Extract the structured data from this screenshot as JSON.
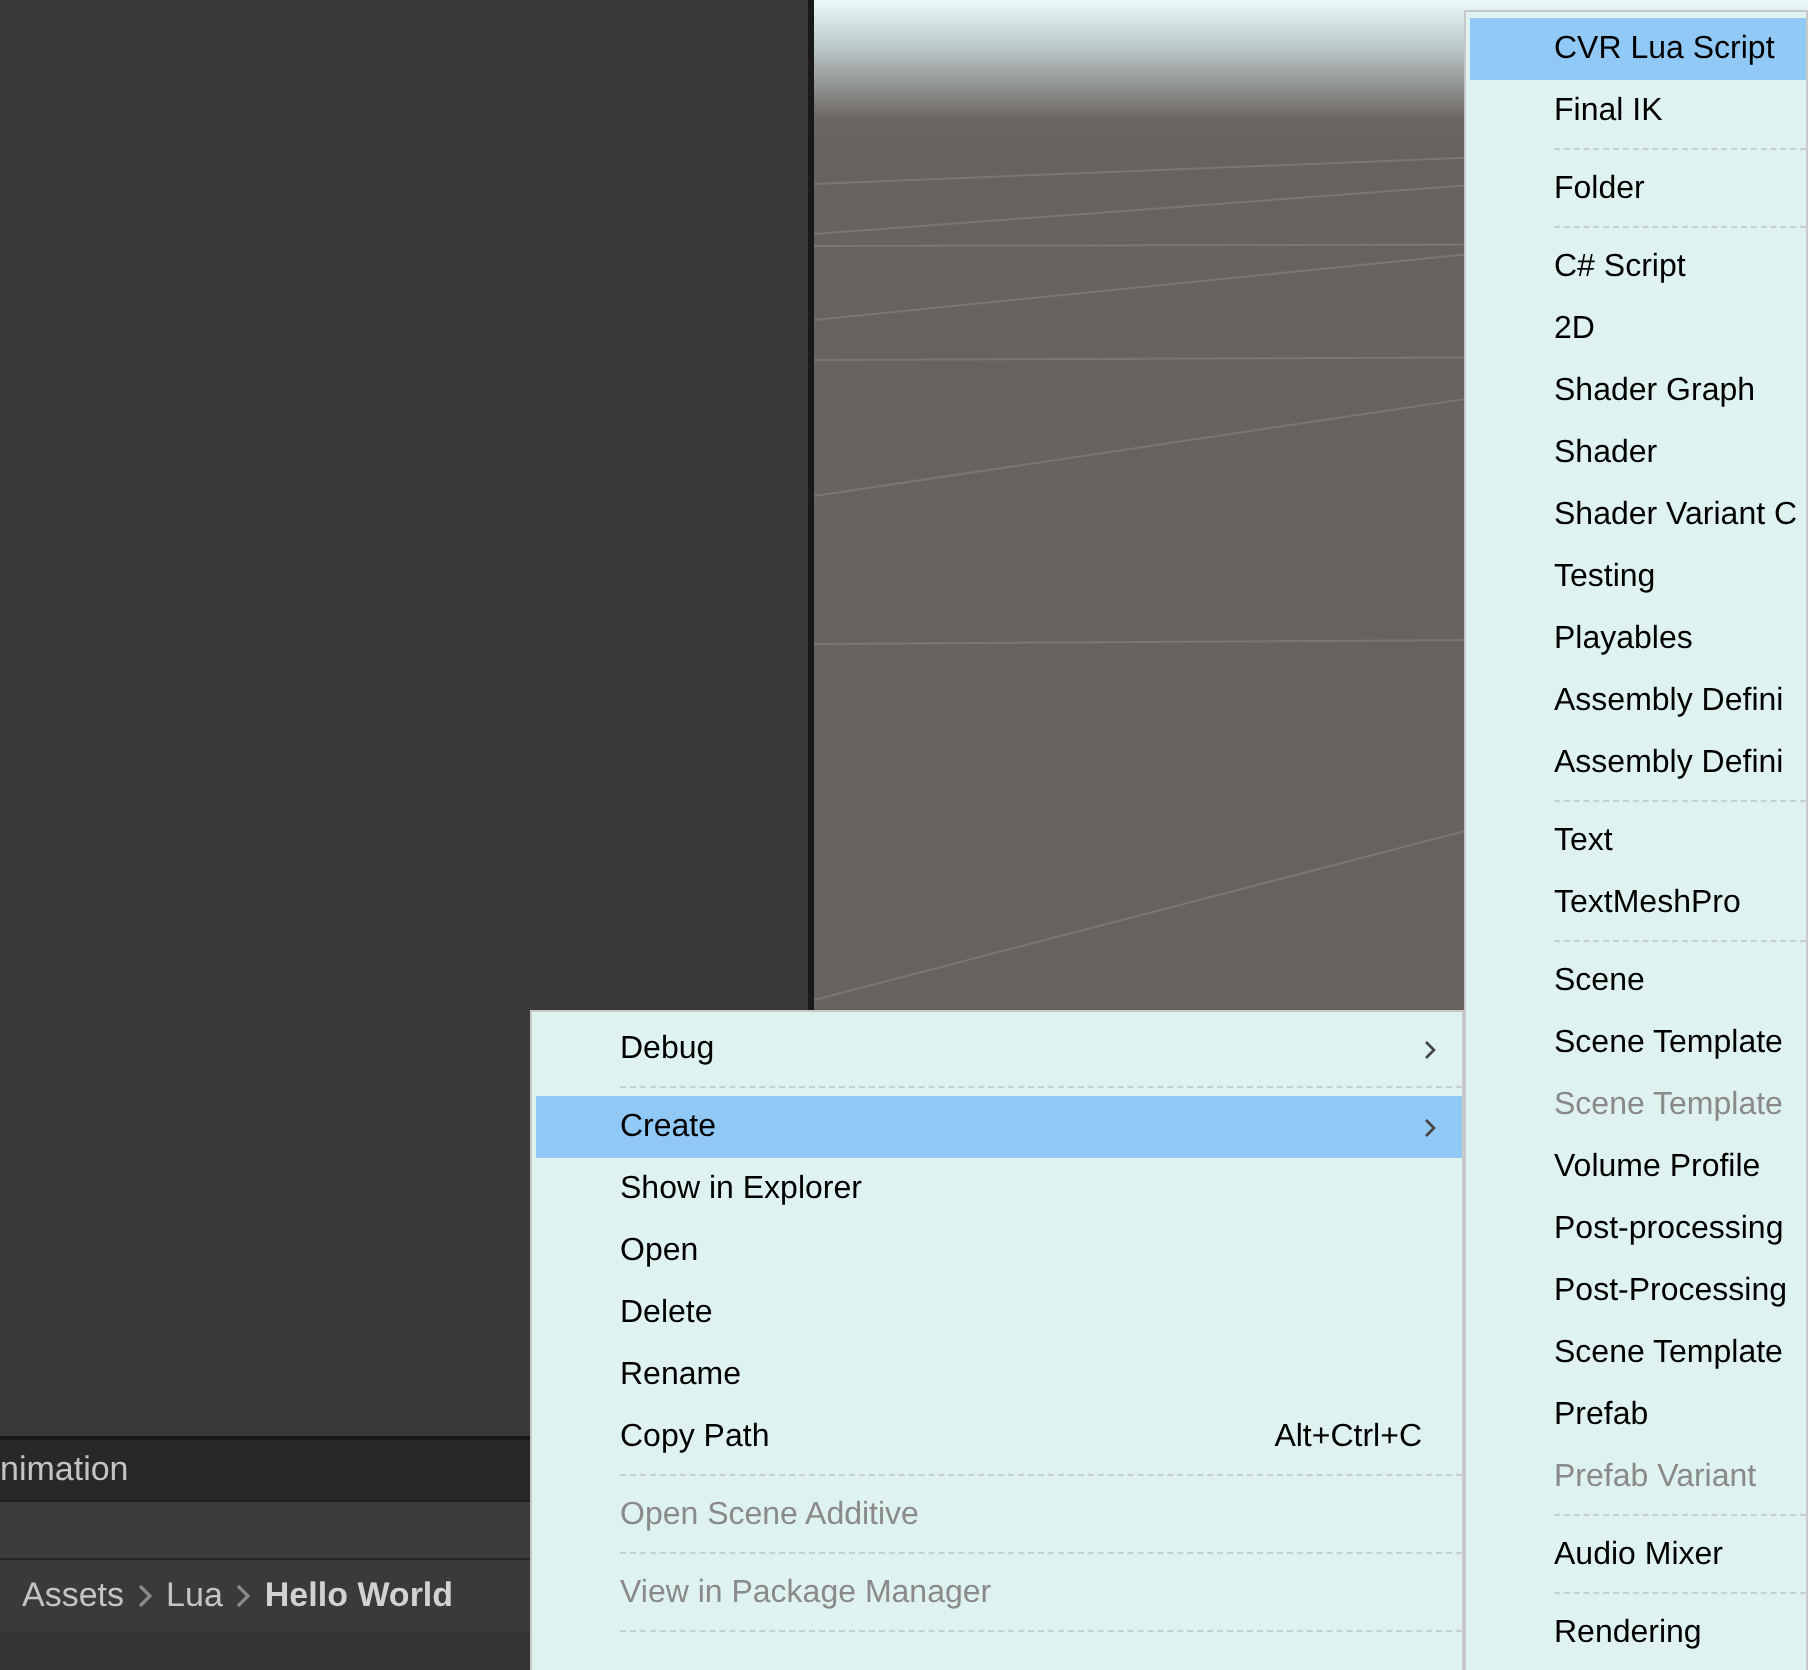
{
  "bottom_panel": {
    "tab": "nimation",
    "breadcrumb": [
      {
        "label": "Assets",
        "current": false
      },
      {
        "label": "Lua",
        "current": false
      },
      {
        "label": "Hello World",
        "current": true
      }
    ]
  },
  "context_menu": {
    "items": [
      {
        "kind": "item",
        "label": "Debug",
        "submenu": true,
        "selected": false,
        "disabled": false
      },
      {
        "kind": "separator"
      },
      {
        "kind": "item",
        "label": "Create",
        "submenu": true,
        "selected": true,
        "disabled": false
      },
      {
        "kind": "item",
        "label": "Show in Explorer",
        "submenu": false,
        "selected": false,
        "disabled": false
      },
      {
        "kind": "item",
        "label": "Open",
        "submenu": false,
        "selected": false,
        "disabled": false
      },
      {
        "kind": "item",
        "label": "Delete",
        "submenu": false,
        "selected": false,
        "disabled": false
      },
      {
        "kind": "item",
        "label": "Rename",
        "submenu": false,
        "selected": false,
        "disabled": false
      },
      {
        "kind": "item",
        "label": "Copy Path",
        "shortcut": "Alt+Ctrl+C",
        "submenu": false,
        "selected": false,
        "disabled": false
      },
      {
        "kind": "separator"
      },
      {
        "kind": "item",
        "label": "Open Scene Additive",
        "submenu": false,
        "selected": false,
        "disabled": true
      },
      {
        "kind": "separator"
      },
      {
        "kind": "item",
        "label": "View in Package Manager",
        "submenu": false,
        "selected": false,
        "disabled": true
      },
      {
        "kind": "separator"
      }
    ]
  },
  "create_submenu": {
    "items": [
      {
        "kind": "item",
        "label": "CVR Lua Script",
        "selected": true,
        "disabled": false
      },
      {
        "kind": "item",
        "label": "Final IK",
        "selected": false,
        "disabled": false
      },
      {
        "kind": "separator"
      },
      {
        "kind": "item",
        "label": "Folder",
        "selected": false,
        "disabled": false
      },
      {
        "kind": "separator"
      },
      {
        "kind": "item",
        "label": "C# Script",
        "selected": false,
        "disabled": false
      },
      {
        "kind": "item",
        "label": "2D",
        "selected": false,
        "disabled": false
      },
      {
        "kind": "item",
        "label": "Shader Graph",
        "selected": false,
        "disabled": false
      },
      {
        "kind": "item",
        "label": "Shader",
        "selected": false,
        "disabled": false
      },
      {
        "kind": "item",
        "label": "Shader Variant C",
        "selected": false,
        "disabled": false
      },
      {
        "kind": "item",
        "label": "Testing",
        "selected": false,
        "disabled": false
      },
      {
        "kind": "item",
        "label": "Playables",
        "selected": false,
        "disabled": false
      },
      {
        "kind": "item",
        "label": "Assembly Defini",
        "selected": false,
        "disabled": false
      },
      {
        "kind": "item",
        "label": "Assembly Defini",
        "selected": false,
        "disabled": false
      },
      {
        "kind": "separator"
      },
      {
        "kind": "item",
        "label": "Text",
        "selected": false,
        "disabled": false
      },
      {
        "kind": "item",
        "label": "TextMeshPro",
        "selected": false,
        "disabled": false
      },
      {
        "kind": "separator"
      },
      {
        "kind": "item",
        "label": "Scene",
        "selected": false,
        "disabled": false
      },
      {
        "kind": "item",
        "label": "Scene Template",
        "selected": false,
        "disabled": false
      },
      {
        "kind": "item",
        "label": "Scene Template",
        "selected": false,
        "disabled": true
      },
      {
        "kind": "item",
        "label": "Volume Profile",
        "selected": false,
        "disabled": false
      },
      {
        "kind": "item",
        "label": "Post-processing",
        "selected": false,
        "disabled": false
      },
      {
        "kind": "item",
        "label": "Post-Processing",
        "selected": false,
        "disabled": false
      },
      {
        "kind": "item",
        "label": "Scene Template",
        "selected": false,
        "disabled": false
      },
      {
        "kind": "item",
        "label": "Prefab",
        "selected": false,
        "disabled": false
      },
      {
        "kind": "item",
        "label": "Prefab Variant",
        "selected": false,
        "disabled": true
      },
      {
        "kind": "separator"
      },
      {
        "kind": "item",
        "label": "Audio Mixer",
        "selected": false,
        "disabled": false
      },
      {
        "kind": "separator"
      },
      {
        "kind": "item",
        "label": "Rendering",
        "selected": false,
        "disabled": false
      }
    ]
  }
}
